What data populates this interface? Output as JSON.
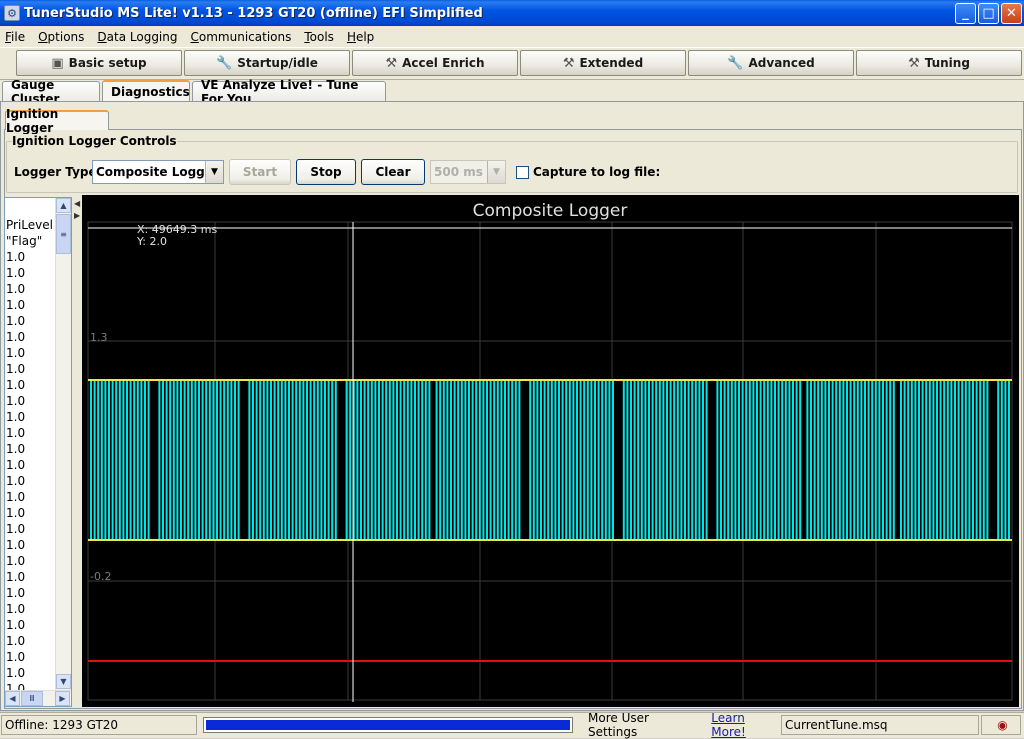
{
  "window": {
    "title": "TunerStudio MS Lite! v1.13 - 1293 GT20 (offline) EFI Simplified",
    "minimize": "_",
    "maximize": "□",
    "close": "✕"
  },
  "menu": [
    "File",
    "Options",
    "Data Logging",
    "Communications",
    "Tools",
    "Help"
  ],
  "toolbar": [
    {
      "label": "Basic setup",
      "icon": "engine-icon"
    },
    {
      "label": "Startup/idle",
      "icon": "wrench-icon"
    },
    {
      "label": "Accel Enrich",
      "icon": "tools-icon"
    },
    {
      "label": "Extended",
      "icon": "hammer-icon"
    },
    {
      "label": "Advanced",
      "icon": "wrench-icon"
    },
    {
      "label": "Tuning",
      "icon": "tools-icon"
    }
  ],
  "tabs": [
    "Gauge Cluster",
    "Diagnostics",
    "VE Analyze Live! - Tune For You"
  ],
  "active_tab": "Diagnostics",
  "subtab": "Ignition Logger",
  "controls": {
    "group_title": "Ignition Logger Controls",
    "logger_type_label": "Logger Type:",
    "logger_type_value": "Composite Logger",
    "start_label": "Start",
    "stop_label": "Stop",
    "clear_label": "Clear",
    "interval_value": "500 ms",
    "capture_label": "Capture to log file:",
    "capture_checked": false
  },
  "list": {
    "header1": "PriLevel",
    "header2": "\"Flag\"",
    "values": [
      "1.0",
      "1.0",
      "1.0",
      "1.0",
      "1.0",
      "1.0",
      "1.0",
      "1.0",
      "1.0",
      "1.0",
      "1.0",
      "1.0",
      "1.0",
      "1.0",
      "1.0",
      "1.0",
      "1.0",
      "1.0",
      "1.0",
      "1.0",
      "1.0",
      "1.0",
      "1.0",
      "1.0",
      "1.0",
      "1.0",
      "1.0",
      "1.0"
    ]
  },
  "chart_data": {
    "type": "line",
    "title": "Composite Logger",
    "cursor_x": "X: 49649.3 ms",
    "cursor_y": "Y: 2.0",
    "y_tick_labels": [
      "1.3",
      "-0.2"
    ],
    "series_colors": {
      "signal": "#00e5e5",
      "signal_top": "#e8e84a",
      "baseline": "#e01010"
    },
    "grid": true
  },
  "status": {
    "offline_text": "Offline: 1293 GT20",
    "progress": 1.0,
    "more_settings": "More User Settings",
    "learn_more": "Learn More!",
    "tune_file": "CurrentTune.msq"
  }
}
